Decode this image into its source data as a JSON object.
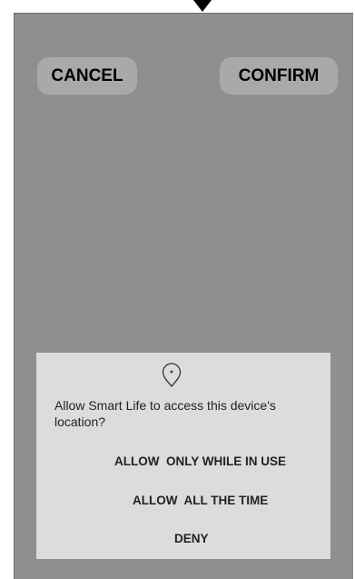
{
  "screen": {
    "cancel_label": "CANCEL",
    "confirm_label": "CONFIRM"
  },
  "permission_dialog": {
    "icon": "location-pin-icon",
    "message": "Allow Smart Life to access this device's location?",
    "options": [
      {
        "label": "ALLOW  ONLY WHILE IN USE"
      },
      {
        "label": "ALLOW  ALL THE TIME"
      },
      {
        "label": "DENY"
      }
    ]
  },
  "colors": {
    "screen_background": "#8f8f8f",
    "button_background": "#a9a9a9",
    "dialog_background": "#dcdcdc"
  }
}
